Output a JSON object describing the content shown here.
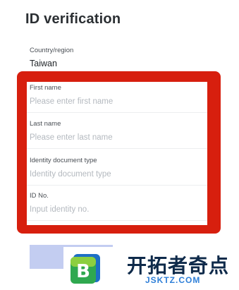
{
  "page": {
    "title": "ID verification"
  },
  "country": {
    "label": "Country/region",
    "value": "Taiwan"
  },
  "form": {
    "fields": [
      {
        "label": "First name",
        "placeholder": "Please enter first name"
      },
      {
        "label": "Last name",
        "placeholder": "Please enter last name"
      },
      {
        "label": "Identity document type",
        "placeholder": "Identity document type"
      },
      {
        "label": "ID No.",
        "placeholder": "Input identity no."
      }
    ]
  },
  "colors": {
    "highlight": "#d71f0e",
    "submit_bar": "#c3cdf1",
    "watermark_text": "#0e2a4a",
    "watermark_url": "#2e7fd8"
  },
  "watermark": {
    "logo_letter": "B",
    "cn_text": "开拓者奇点",
    "url_text": "JSKTZ.COM"
  }
}
